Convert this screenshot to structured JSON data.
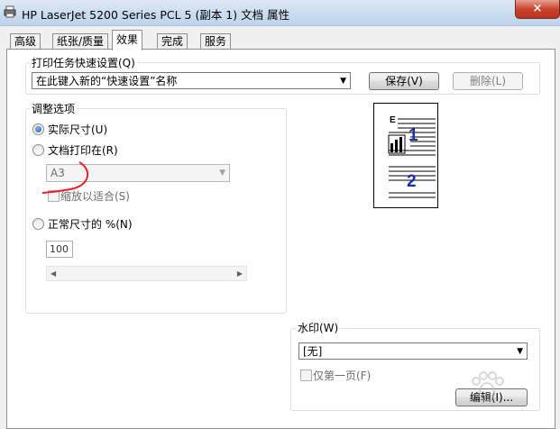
{
  "window": {
    "title": "HP LaserJet 5200 Series PCL 5 (副本 1) 文档 属性",
    "close_label": "×"
  },
  "tabs": [
    {
      "label": "高级"
    },
    {
      "label": "纸张/质量"
    },
    {
      "label": "效果"
    },
    {
      "label": "完成"
    },
    {
      "label": "服务"
    }
  ],
  "quick_set": {
    "group_label": "打印任务快速设置(Q)",
    "combo_value": "在此键入新的“快速设置”名称",
    "save_label": "保存(V)",
    "delete_label": "删除(L)"
  },
  "resize": {
    "group_label": "调整选项",
    "actual_size_label": "实际尺寸(U)",
    "actual_size_selected": true,
    "print_on_label": "文档打印在(R)",
    "paper_value": "A3",
    "scale_to_fit_label": "缩放以适合(S)",
    "percent_label": "正常尺寸的 %(N)",
    "percent_value": "100"
  },
  "preview": {
    "page1": "1",
    "page2": "2",
    "header_letter": "E"
  },
  "watermark": {
    "group_label": "水印(W)",
    "combo_value": "[无]",
    "first_page_label": "仅第一页(F)",
    "edit_label": "编辑(I)..."
  },
  "colors": {
    "accent_number": "#1a2fa8",
    "annotation_red": "#e8202a"
  }
}
